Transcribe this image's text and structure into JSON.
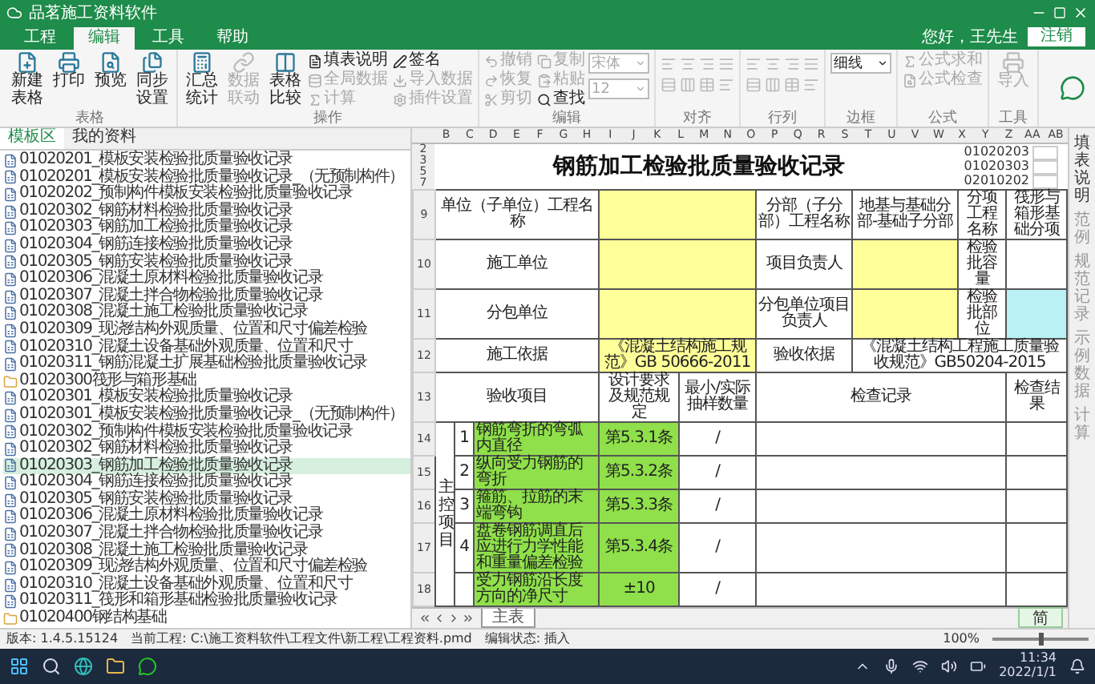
{
  "window": {
    "title": "品茗施工资料软件",
    "user": "您好，王先生",
    "logout": "注销"
  },
  "menu_tabs": [
    {
      "label": "工程",
      "selected": false
    },
    {
      "label": "编辑",
      "selected": true
    },
    {
      "label": "工具",
      "selected": false
    },
    {
      "label": "帮助",
      "selected": false
    }
  ],
  "ribbon": {
    "groups": [
      {
        "label": "表格",
        "items": [
          {
            "kind": "big",
            "label": "新建表格",
            "disabled": false
          },
          {
            "kind": "big",
            "label": "打印",
            "disabled": false
          },
          {
            "kind": "big",
            "label": "预览",
            "disabled": false
          },
          {
            "kind": "big",
            "label": "同步设置",
            "disabled": false
          }
        ]
      },
      {
        "label": "操作",
        "items": [
          {
            "kind": "big",
            "label": "汇总统计",
            "disabled": false
          },
          {
            "kind": "big",
            "label": "数据联动",
            "disabled": true
          },
          {
            "kind": "big",
            "label": "表格比较",
            "disabled": false
          },
          {
            "kind": "small",
            "label": "填表说明",
            "disabled": false
          },
          {
            "kind": "small",
            "label": "全局数据",
            "disabled": true
          },
          {
            "kind": "small",
            "label": "计算",
            "disabled": true
          },
          {
            "kind": "small",
            "label": "签名",
            "disabled": false
          },
          {
            "kind": "small",
            "label": "导入数据",
            "disabled": true
          },
          {
            "kind": "small",
            "label": "插件设置",
            "disabled": true
          }
        ]
      },
      {
        "label": "编辑",
        "items": [
          {
            "kind": "small",
            "label": "撤销",
            "disabled": true
          },
          {
            "kind": "small",
            "label": "恢复",
            "disabled": true
          },
          {
            "kind": "small",
            "label": "剪切",
            "disabled": true
          },
          {
            "kind": "small",
            "label": "复制",
            "disabled": true
          },
          {
            "kind": "small",
            "label": "粘贴",
            "disabled": true
          },
          {
            "kind": "small",
            "label": "查找",
            "disabled": false
          },
          {
            "kind": "select",
            "label": "宋体",
            "disabled": true
          },
          {
            "kind": "select",
            "label": "12",
            "disabled": true
          }
        ]
      },
      {
        "label": "对齐",
        "items": [
          {
            "kind": "icons",
            "disabled": true
          }
        ]
      },
      {
        "label": "行列",
        "items": [
          {
            "kind": "icons",
            "disabled": true
          }
        ]
      },
      {
        "label": "边框",
        "items": [
          {
            "kind": "select",
            "label": "细线",
            "disabled": false
          }
        ]
      },
      {
        "label": "公式",
        "items": [
          {
            "kind": "small",
            "label": "公式求和",
            "disabled": true
          },
          {
            "kind": "small",
            "label": "公式检查",
            "disabled": true
          }
        ]
      },
      {
        "label": "工具",
        "items": [
          {
            "kind": "big",
            "label": "导入",
            "disabled": true
          }
        ]
      }
    ]
  },
  "left_panel": {
    "tabs": [
      {
        "label": "模板区",
        "selected": true
      },
      {
        "label": "我的资料",
        "selected": false
      }
    ],
    "items": [
      {
        "kind": "file",
        "label": "01020201_模板安装检验批质量验收记录",
        "selected": false
      },
      {
        "kind": "file",
        "label": "01020201_模板安装检验批质量验收记录_（无预制构件）",
        "selected": false
      },
      {
        "kind": "file",
        "label": "01020202_预制构件模板安装检验批质量验收记录",
        "selected": false
      },
      {
        "kind": "file",
        "label": "01020302_钢筋材料检验批质量验收记录",
        "selected": false
      },
      {
        "kind": "file",
        "label": "01020303_钢筋加工检验批质量验收记录",
        "selected": false
      },
      {
        "kind": "file",
        "label": "01020304_钢筋连接检验批质量验收记录",
        "selected": false
      },
      {
        "kind": "file",
        "label": "01020305_钢筋安装检验批质量验收记录",
        "selected": false
      },
      {
        "kind": "file",
        "label": "01020306_混凝土原材料检验批质量验收记录",
        "selected": false
      },
      {
        "kind": "file",
        "label": "01020307_混凝土拌合物检验批质量验收记录",
        "selected": false
      },
      {
        "kind": "file",
        "label": "01020308_混凝土施工检验批质量验收记录",
        "selected": false
      },
      {
        "kind": "file",
        "label": "01020309_现浇结构外观质量、位置和尺寸偏差检验",
        "selected": false
      },
      {
        "kind": "file",
        "label": "01020310_混凝土设备基础外观质量、位置和尺寸",
        "selected": false
      },
      {
        "kind": "file",
        "label": "01020311_钢筋混凝土扩展基础检验批质量验收记录",
        "selected": false
      },
      {
        "kind": "folder",
        "label": "01020300筏形与箱形基础",
        "selected": false
      },
      {
        "kind": "file",
        "label": "01020301_模板安装检验批质量验收记录",
        "selected": false
      },
      {
        "kind": "file",
        "label": "01020301_模板安装检验批质量验收记录_（无预制构件）",
        "selected": false
      },
      {
        "kind": "file",
        "label": "01020302_预制构件模板安装检验批质量验收记录",
        "selected": false
      },
      {
        "kind": "file",
        "label": "01020302_钢筋材料检验批质量验收记录",
        "selected": false
      },
      {
        "kind": "file",
        "label": "01020303_钢筋加工检验批质量验收记录",
        "selected": true
      },
      {
        "kind": "file",
        "label": "01020304_钢筋连接检验批质量验收记录",
        "selected": false
      },
      {
        "kind": "file",
        "label": "01020305_钢筋安装检验批质量验收记录",
        "selected": false
      },
      {
        "kind": "file",
        "label": "01020306_混凝土原材料检验批质量验收记录",
        "selected": false
      },
      {
        "kind": "file",
        "label": "01020307_混凝土拌合物检验批质量验收记录",
        "selected": false
      },
      {
        "kind": "file",
        "label": "01020308_混凝土施工检验批质量验收记录",
        "selected": false
      },
      {
        "kind": "file",
        "label": "01020309_现浇结构外观质量、位置和尺寸偏差检验",
        "selected": false
      },
      {
        "kind": "file",
        "label": "01020310_混凝土设备基础外观质量、位置和尺寸",
        "selected": false
      },
      {
        "kind": "file",
        "label": "01020311_筏形和箱形基础检验批质量验收记录",
        "selected": false
      },
      {
        "kind": "folder",
        "label": "01020400钢结构基础",
        "selected": false
      }
    ]
  },
  "sheet": {
    "letters": [
      "B",
      "C",
      "D",
      "E",
      "F",
      "G",
      "H",
      "I",
      "J",
      "K",
      "L",
      "M",
      "N",
      "O",
      "P",
      "Q",
      "R",
      "S",
      "T",
      "U",
      "V",
      "W",
      "X",
      "Y",
      "Z",
      "AA",
      "AB"
    ],
    "title_row": "2",
    "title": "钢筋加工检验批质量验收记录",
    "code_rows": [
      "3",
      "5",
      "7"
    ],
    "codes": [
      "01020203",
      "01020303",
      "02010202"
    ],
    "form_rows": [
      {
        "num": "9",
        "cells": [
          {
            "text": "单位（子单位）工程名称",
            "kind": "label"
          },
          {
            "kind": "yellow"
          },
          {
            "text": "分部（子分部）工程名称",
            "kind": "label"
          },
          {
            "text": "地基与基础分部-基础子分部",
            "kind": "label"
          },
          {
            "text": "分项工程名称",
            "kind": "label"
          },
          {
            "text": "筏形与箱形基础分项",
            "kind": "label"
          }
        ]
      },
      {
        "num": "10",
        "cells": [
          {
            "text": "施工单位",
            "kind": "label"
          },
          {
            "kind": "yellow"
          },
          {
            "text": "项目负责人",
            "kind": "label"
          },
          {
            "kind": "yellow"
          },
          {
            "text": "检验批容量",
            "kind": "label"
          },
          {
            "kind": "white"
          }
        ]
      },
      {
        "num": "11",
        "cells": [
          {
            "text": "分包单位",
            "kind": "label"
          },
          {
            "kind": "yellow"
          },
          {
            "text": "分包单位项目负责人",
            "kind": "label"
          },
          {
            "kind": "yellow"
          },
          {
            "text": "检验批部位",
            "kind": "label"
          },
          {
            "kind": "cyan"
          }
        ]
      },
      {
        "num": "12",
        "cells": [
          {
            "text": "施工依据",
            "kind": "label"
          },
          {
            "text": "《混凝土结构施工规范》GB 50666-2011",
            "kind": "yellow"
          },
          {
            "text": "验收依据",
            "kind": "label"
          },
          {
            "text": "《混凝土结构工程施工质量验收规范》GB50204-2015",
            "kind": "label"
          }
        ]
      },
      {
        "num": "13",
        "cells": [
          {
            "text": "验收项目",
            "kind": "label"
          },
          {
            "text": "设计要求及规范规定",
            "kind": "label"
          },
          {
            "text": "最小/实际抽样数量",
            "kind": "label"
          },
          {
            "text": "检查记录",
            "kind": "label"
          },
          {
            "text": "检查结果",
            "kind": "label"
          }
        ]
      }
    ],
    "group_label": "主控项目",
    "items": [
      {
        "num": "14",
        "no": "1",
        "item": "钢筋弯折的弯弧内直径",
        "requirement": "第5.3.1条",
        "sample": "/"
      },
      {
        "num": "15",
        "no": "2",
        "item": "纵向受力钢筋的弯折",
        "requirement": "第5.3.2条",
        "sample": "/"
      },
      {
        "num": "16",
        "no": "3",
        "item": "箍筋、拉筋的末端弯钩",
        "requirement": "第5.3.3条",
        "sample": "/"
      },
      {
        "num": "17",
        "no": "4",
        "item": "盘卷钢筋调直后应进行力学性能和重量偏差检验",
        "requirement": "第5.3.4条",
        "sample": "/"
      },
      {
        "num": "18",
        "item": "受力钢筋沿长度方向的净尺寸",
        "requirement": "±10",
        "sample": "/"
      }
    ],
    "sheet_tabs": [
      {
        "label": "主表",
        "selected": true
      }
    ]
  },
  "side_tabs": [
    {
      "label": "填表说明",
      "selected": true
    },
    {
      "label": "范例",
      "selected": false
    },
    {
      "label": "规范记录",
      "selected": false
    },
    {
      "label": "示例数据",
      "selected": false
    },
    {
      "label": "计算",
      "selected": false
    }
  ],
  "ime_widget": {
    "label": "简"
  },
  "status_bar": {
    "version": "版本: 1.4.5.15124",
    "project": "当前工程: C:\\施工资料软件\\工程文件\\新工程\\工程资料.pmd",
    "mode": "编辑状态: 插入",
    "zoom": "100%",
    "zoom_level": {
      "level": 0.5
    }
  },
  "taskbar": {
    "time": "11:34",
    "date": "2022/1/1"
  }
}
